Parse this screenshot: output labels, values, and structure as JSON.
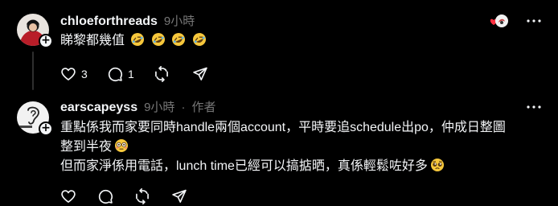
{
  "posts": [
    {
      "username": "chloeforthreads",
      "timestamp": "9小時",
      "text_lines": [
        "睇黎都幾值"
      ],
      "emoji_after_text": [
        "rolling-on-floor-laughing-icon",
        "rolling-on-floor-laughing-icon",
        "rolling-on-floor-laughing-icon",
        "rolling-on-floor-laughing-icon"
      ],
      "actions": {
        "like_count": "3",
        "comment_count": "1"
      },
      "icons": {
        "like": "heart-outline-icon",
        "comment": "speech-bubble-icon",
        "repost": "repost-arrows-icon",
        "share": "paper-plane-icon",
        "more": "more-dots-icon",
        "liked_by": "heart-sticker-icon"
      }
    },
    {
      "username": "earscapeyss",
      "timestamp": "9小時",
      "separator": "·",
      "author_tag": "作者",
      "text_lines": [
        "重點係我而家要同時handle兩個account，平時要追schedule出po，仲成日整圖",
        "整到半夜",
        "但而家淨係用電話，lunch time已經可以搞掂晒，真係輕鬆咗好多"
      ],
      "line_emoji": [
        "",
        "flushed-face-icon",
        "pleading-face-icon"
      ],
      "icons": {
        "like": "heart-outline-icon",
        "comment": "speech-bubble-icon",
        "repost": "repost-arrows-icon",
        "share": "paper-plane-icon",
        "more": "more-dots-icon"
      }
    }
  ],
  "colors": {
    "background": "#000000",
    "text_primary": "#f3f5f7",
    "text_secondary": "#777777",
    "accent_red": "#ff3040",
    "emoji_yellow": "#f7c83c"
  }
}
